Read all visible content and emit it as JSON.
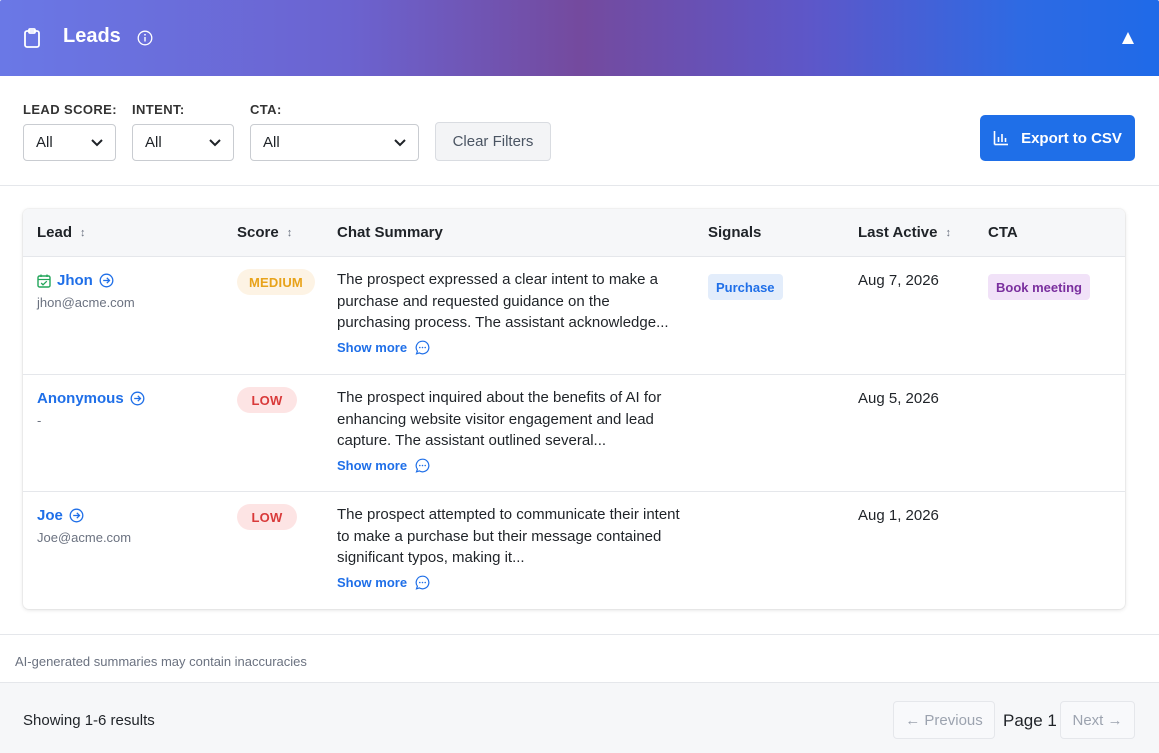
{
  "header": {
    "title": "Leads"
  },
  "filters": {
    "lead_score": {
      "label": "LEAD SCORE:",
      "value": "All"
    },
    "intent": {
      "label": "INTENT:",
      "value": "All"
    },
    "cta": {
      "label": "CTA:",
      "value": "All"
    },
    "clear_label": "Clear Filters",
    "export_label": "Export to CSV"
  },
  "table": {
    "columns": [
      "Lead",
      "Score",
      "Chat Summary",
      "Signals",
      "Last Active",
      "CTA"
    ],
    "rows": [
      {
        "name": "Jhon",
        "email": "jhon@acme.com",
        "score": "MEDIUM",
        "summary": "The prospect expressed a clear intent to make a purchase and requested guidance on the purchasing process. The assistant acknowledge...",
        "show_more": "Show more",
        "signal": "Purchase",
        "last_active": "Aug 7, 2026",
        "cta": "Book meeting"
      },
      {
        "name": "Anonymous",
        "email": "-",
        "score": "LOW",
        "summary": "The prospect inquired about the benefits of AI for enhancing website visitor engagement and lead capture. The assistant outlined several...",
        "show_more": "Show more",
        "signal": "",
        "last_active": "Aug 5, 2026",
        "cta": ""
      },
      {
        "name": "Joe",
        "email": "Joe@acme.com",
        "score": "LOW",
        "summary": "The prospect attempted to communicate their intent to make a purchase but their message contained significant typos, making it...",
        "show_more": "Show more",
        "signal": "",
        "last_active": "Aug 1, 2026",
        "cta": ""
      }
    ]
  },
  "disclaimer": "AI-generated summaries may contain inaccuracies",
  "footer": {
    "results": "Showing 1-6 results",
    "previous": "← Previous",
    "page": "Page 1",
    "next": "Next →"
  },
  "colors": {
    "primary": "#1f6fe8",
    "medium_badge": "#e8a31b",
    "low_badge": "#d93a3a",
    "cta_badge": "#7a2f9e"
  }
}
